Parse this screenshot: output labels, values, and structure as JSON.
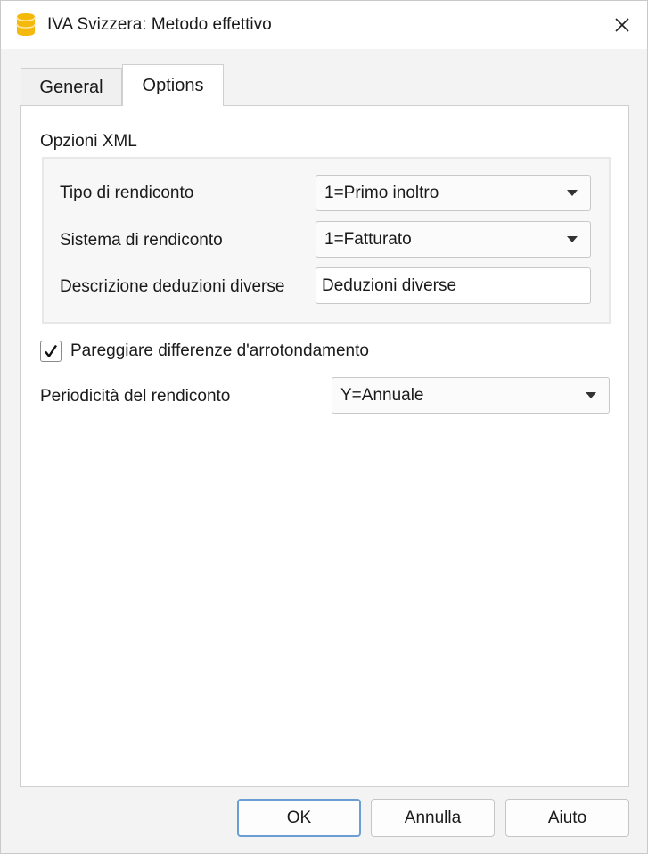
{
  "window": {
    "title": "IVA Svizzera: Metodo effettivo",
    "app_icon": "database-icon",
    "close_icon": "close-icon",
    "accent_color": "#f5b90c"
  },
  "tabs": [
    {
      "label": "General",
      "selected": false
    },
    {
      "label": "Options",
      "selected": true
    }
  ],
  "xml_options": {
    "group_title": "Opzioni XML",
    "report_type_label": "Tipo di rendiconto",
    "report_type_value": "1=Primo inoltro",
    "report_system_label": "Sistema di rendiconto",
    "report_system_value": "1=Fatturato",
    "deductions_label": "Descrizione deduzioni diverse",
    "deductions_value": "Deduzioni diverse"
  },
  "rounding": {
    "label": "Pareggiare differenze d'arrotondamento",
    "checked": true
  },
  "periodicity": {
    "label": "Periodicità del rendiconto",
    "value": "Y=Annuale"
  },
  "buttons": {
    "ok": "OK",
    "cancel": "Annulla",
    "help": "Aiuto"
  }
}
